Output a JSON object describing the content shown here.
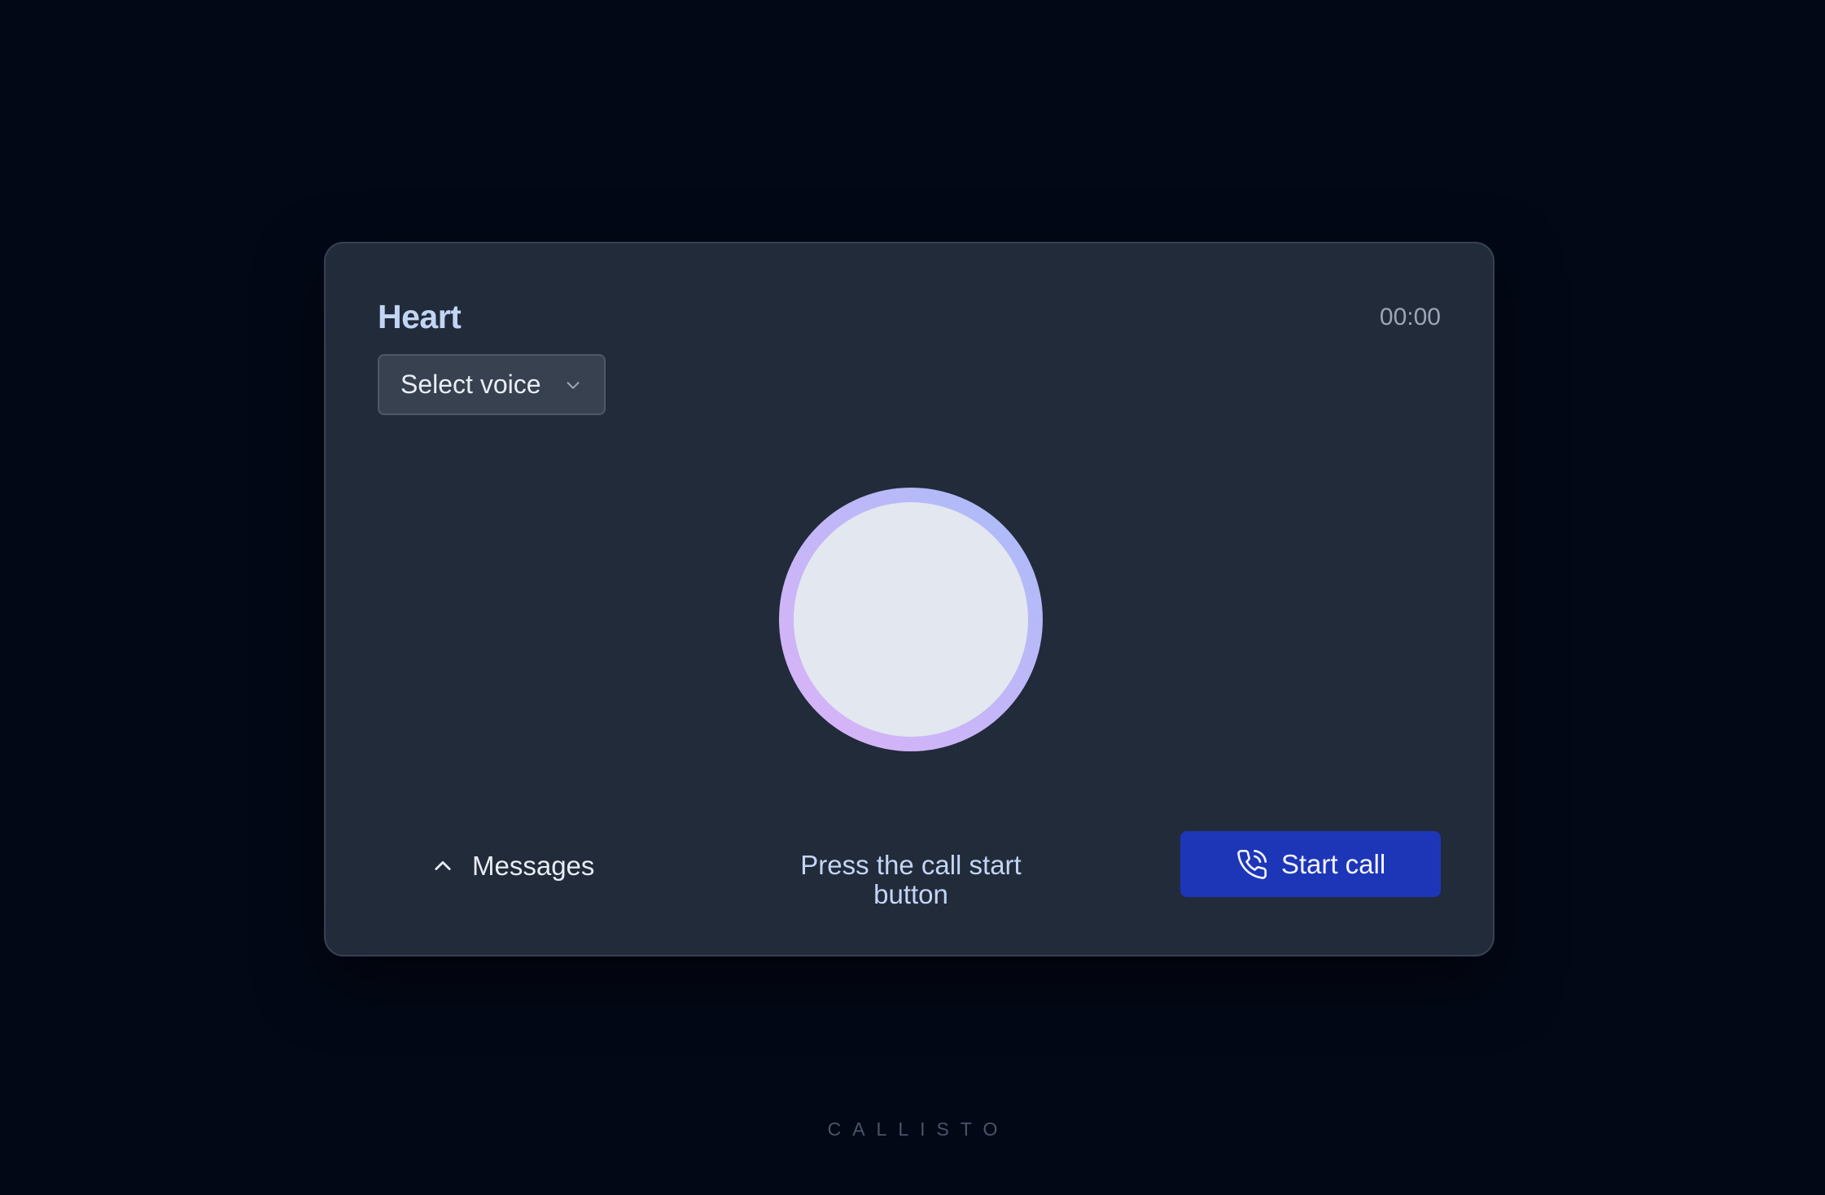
{
  "card": {
    "title": "Heart",
    "timer": "00:00",
    "voice_select": {
      "selected": "Select voice",
      "icon": "chevron-down-icon"
    },
    "orb": {
      "ring_colors": [
        "#a8bdf9",
        "#c3b6f8",
        "#dcb3f7"
      ],
      "core_color": "#e3e7ef"
    },
    "messages_toggle": {
      "label": "Messages",
      "icon": "chevron-up-icon"
    },
    "status_text": "Press the call start button",
    "start_call": {
      "label": "Start call",
      "icon": "phone-call-icon",
      "color": "#1d36b8"
    }
  },
  "brand": "CALLISTO",
  "colors": {
    "background": "#030817",
    "card": "#222b3a",
    "accent": "#1d36b8",
    "title": "#c3d5f5"
  }
}
